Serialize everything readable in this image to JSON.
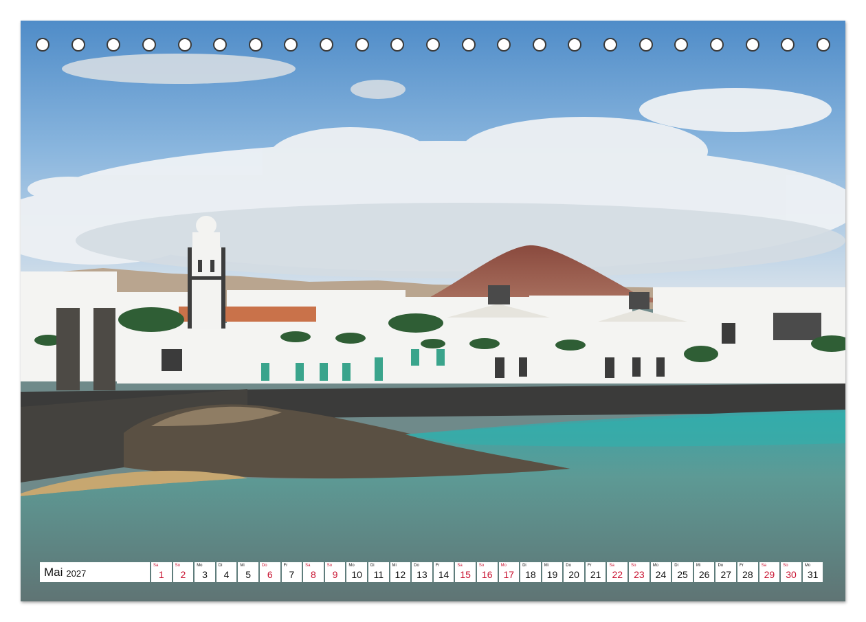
{
  "calendar": {
    "month": "Mai",
    "year": "2027",
    "colors": {
      "weekday": "#111111",
      "weekend_holiday": "#c8102e"
    },
    "days": [
      {
        "wd": "Sa",
        "d": "1",
        "red": true
      },
      {
        "wd": "So",
        "d": "2",
        "red": true
      },
      {
        "wd": "Mo",
        "d": "3",
        "red": false
      },
      {
        "wd": "Di",
        "d": "4",
        "red": false
      },
      {
        "wd": "Mi",
        "d": "5",
        "red": false
      },
      {
        "wd": "Do",
        "d": "6",
        "red": true
      },
      {
        "wd": "Fr",
        "d": "7",
        "red": false
      },
      {
        "wd": "Sa",
        "d": "8",
        "red": true
      },
      {
        "wd": "So",
        "d": "9",
        "red": true
      },
      {
        "wd": "Mo",
        "d": "10",
        "red": false
      },
      {
        "wd": "Di",
        "d": "11",
        "red": false
      },
      {
        "wd": "Mi",
        "d": "12",
        "red": false
      },
      {
        "wd": "Do",
        "d": "13",
        "red": false
      },
      {
        "wd": "Fr",
        "d": "14",
        "red": false
      },
      {
        "wd": "Sa",
        "d": "15",
        "red": true
      },
      {
        "wd": "So",
        "d": "16",
        "red": true
      },
      {
        "wd": "Mo",
        "d": "17",
        "red": true
      },
      {
        "wd": "Di",
        "d": "18",
        "red": false
      },
      {
        "wd": "Mi",
        "d": "19",
        "red": false
      },
      {
        "wd": "Do",
        "d": "20",
        "red": false
      },
      {
        "wd": "Fr",
        "d": "21",
        "red": false
      },
      {
        "wd": "Sa",
        "d": "22",
        "red": true
      },
      {
        "wd": "So",
        "d": "23",
        "red": true
      },
      {
        "wd": "Mo",
        "d": "24",
        "red": false
      },
      {
        "wd": "Di",
        "d": "25",
        "red": false
      },
      {
        "wd": "Mi",
        "d": "26",
        "red": false
      },
      {
        "wd": "Do",
        "d": "27",
        "red": false
      },
      {
        "wd": "Fr",
        "d": "28",
        "red": false
      },
      {
        "wd": "Sa",
        "d": "29",
        "red": true
      },
      {
        "wd": "So",
        "d": "30",
        "red": true
      },
      {
        "wd": "Mo",
        "d": "31",
        "red": false
      }
    ]
  },
  "binding": {
    "hole_count": 23
  }
}
